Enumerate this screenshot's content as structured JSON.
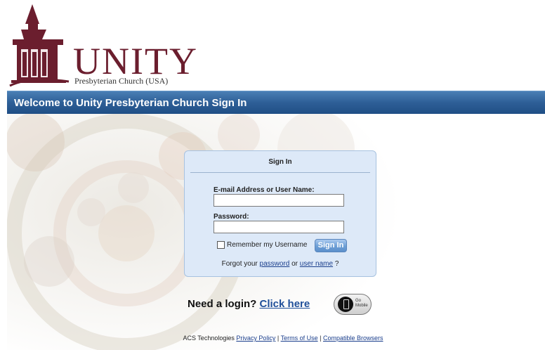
{
  "logo": {
    "wordmark": "UNITY",
    "subtitle": "Presbyterian Church (USA)"
  },
  "banner": {
    "title": "Welcome to Unity Presbyterian Church Sign In"
  },
  "signin": {
    "title": "Sign In",
    "email_label": "E-mail Address or User Name:",
    "email_value": "",
    "password_label": "Password:",
    "password_value": "",
    "remember_label": "Remember my Username",
    "remember_checked": false,
    "button_label": "Sign In",
    "forgot_prefix": "Forgot your",
    "forgot_password_link": "password",
    "forgot_or": "or",
    "forgot_username_link": "user name",
    "forgot_suffix": "?"
  },
  "need_login": {
    "text": "Need a login?",
    "link": "Click here"
  },
  "go_mobile": {
    "line1": "Go",
    "line2": "Mobile"
  },
  "footer": {
    "company": "ACS Technologies",
    "privacy": "Privacy Policy",
    "sep": "|",
    "terms": "Terms of Use",
    "browsers": "Compatible Browsers"
  },
  "colors": {
    "brand": "#6b1e2e",
    "banner": "#2e5f97",
    "panel": "#dde9f8",
    "link": "#1a3e8c"
  }
}
